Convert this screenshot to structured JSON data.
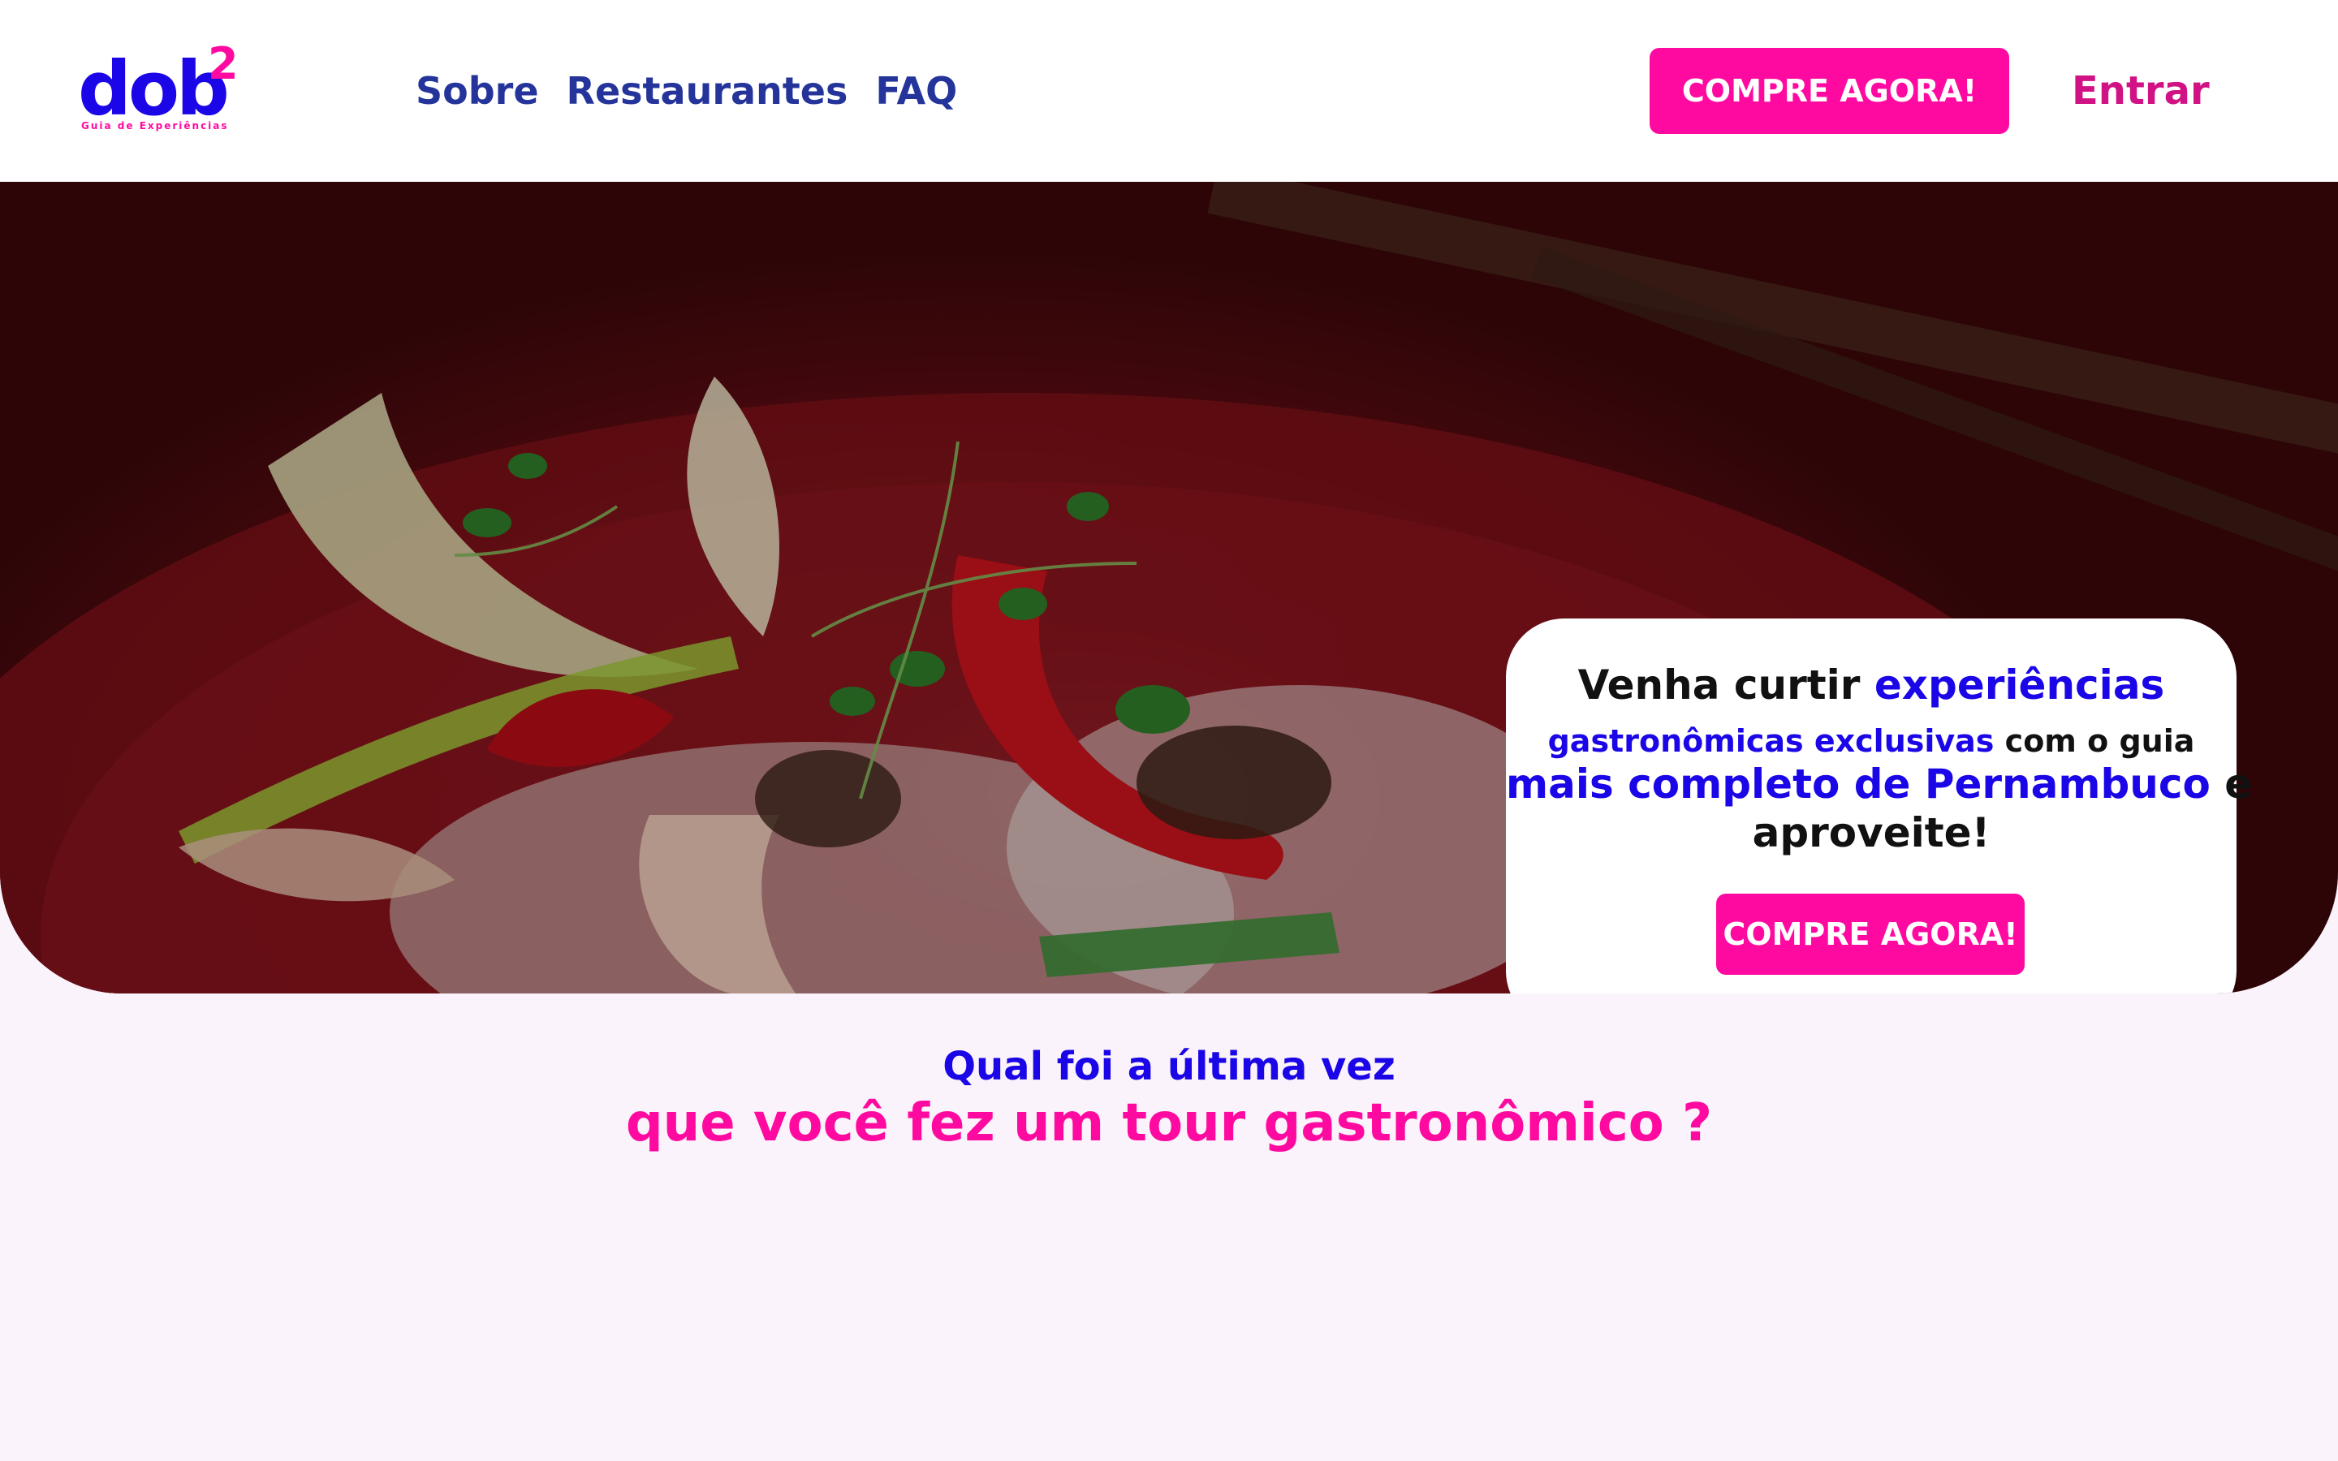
{
  "brand": {
    "logo_text": "dob",
    "logo_superscript": "2",
    "tagline": "Guia de Experiências",
    "primary_color": "#1a06e6",
    "accent_color": "#ff0aa0"
  },
  "nav": {
    "items": [
      {
        "label": "Sobre"
      },
      {
        "label": "Restaurantes"
      },
      {
        "label": "FAQ"
      }
    ]
  },
  "header": {
    "cta_label": "COMPRE AGORA!",
    "login_label": "Entrar"
  },
  "hero": {
    "image": "food-dish-photo",
    "card": {
      "line1_a": "Venha curtir ",
      "line1_b": "experiências",
      "line2_a": "gastronômicas exclusivas",
      "line2_b": " com o guia",
      "line3_a": "mais completo de Pernambuco",
      "line3_b": " e",
      "line4": "aproveite!",
      "cta_label": "COMPRE AGORA!"
    }
  },
  "question": {
    "line1": "Qual foi a última vez",
    "line2": "que você fez um tour gastronômico ?"
  }
}
